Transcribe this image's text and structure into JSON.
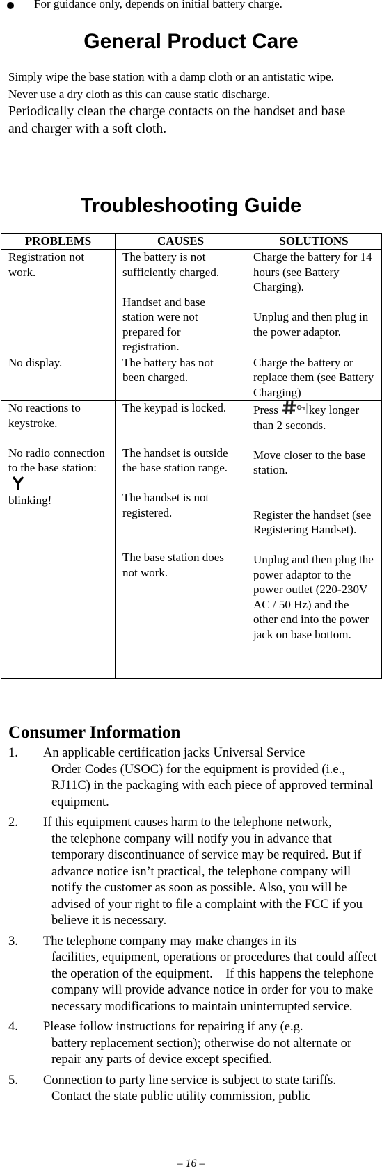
{
  "top_bullet": "For guidance only, depends on initial battery charge.",
  "product_care": {
    "title": "General Product Care",
    "lines": [
      "Simply wipe the base station with a damp cloth or an antistatic wipe.",
      "Never use a dry cloth as this can cause static discharge.",
      "Periodically clean the charge contacts on the handset and base",
      "and charger with a soft cloth."
    ]
  },
  "troubleshooting": {
    "title": "Troubleshooting Guide",
    "headers": [
      "PROBLEMS",
      "CAUSES",
      "SOLUTIONS"
    ],
    "rows": [
      {
        "problems": [
          "Registration not work."
        ],
        "causes": [
          "The battery is not sufficiently charged.",
          "Handset and base station were not prepared for registration."
        ],
        "solutions": [
          "Charge the battery for 14 hours (see Battery Charging).",
          "Unplug and then plug in the power adaptor."
        ]
      },
      {
        "problems": [
          "No display."
        ],
        "causes": [
          "The battery has not been charged."
        ],
        "solutions": [
          "Charge the battery or replace them (see Battery Charging)"
        ]
      },
      {
        "problems": [
          "No reactions to keystroke.",
          "No radio connection to the base station:",
          "blinking!"
        ],
        "problem_icon": "antenna-icon",
        "causes": [
          "The keypad is locked.",
          "The handset is outside the base station range.",
          "The handset is not registered.",
          "The base station does not work."
        ],
        "solutions": [
          "Press",
          "key longer than 2 seconds.",
          "Move closer to the base station.",
          "Register the handset (see Registering Handset).",
          "Unplug and then plug the power adaptor to the power outlet (220-230V AC / 50 Hz) and the other end into the power jack on base bottom."
        ],
        "solution_icon": "hash-key-lock-icon"
      }
    ]
  },
  "consumer": {
    "title": "Consumer Information",
    "items": [
      {
        "num": "1.",
        "first": "An applicable certification jacks Universal Service",
        "rest": "Order Codes (USOC) for the equipment is provided (i.e., RJ11C) in the packaging with each piece of approved terminal equipment."
      },
      {
        "num": "2.",
        "first": "If this equipment causes harm to the telephone network,",
        "rest": "the telephone company will notify you in advance that temporary discontinuance of service may be required. But if advance notice isn’t practical, the telephone company will notify the customer as soon as possible. Also, you will be advised of your right to file a complaint with the FCC if you believe it is necessary."
      },
      {
        "num": "3.",
        "first": "The telephone company may make changes in its",
        "rest": "facilities, equipment, operations or procedures that could affect the operation of the equipment.    If this happens the telephone company will provide advance notice in order for you to make necessary modifications to maintain uninterrupted service."
      },
      {
        "num": "4.",
        "first": "Please follow instructions for repairing if any (e.g.",
        "rest": "battery replacement section); otherwise do not alternate or repair any parts of device except specified."
      },
      {
        "num": "5.",
        "first": "Connection to party line service is subject to state tariffs.",
        "rest": "Contact the state public utility commission, public"
      }
    ]
  },
  "footer": {
    "page": "– 16 –"
  }
}
